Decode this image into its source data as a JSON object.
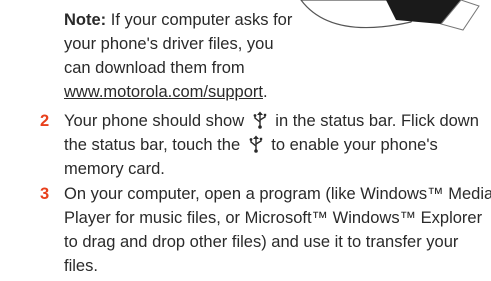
{
  "note": {
    "label": "Note:",
    "text_before": " If your computer asks for your phone's driver files, you can download them from ",
    "link": "www.motorola.com/support",
    "text_after": "."
  },
  "steps": [
    {
      "number": "2",
      "t1": "Your phone should show",
      "icon1": "usb-icon",
      "t2": "in the status bar. Flick down the status bar, touch the",
      "icon2": "usb-icon",
      "t3": "to enable your phone's memory card."
    },
    {
      "number": "3",
      "text": "On your computer, open a program (like Windows™ Media Player for music files, or Microsoft™ Windows™ Explorer to drag and drop other files) and use it to transfer your files."
    }
  ],
  "colors": {
    "step_number": "#e8401c",
    "text": "#2a2a2a"
  }
}
